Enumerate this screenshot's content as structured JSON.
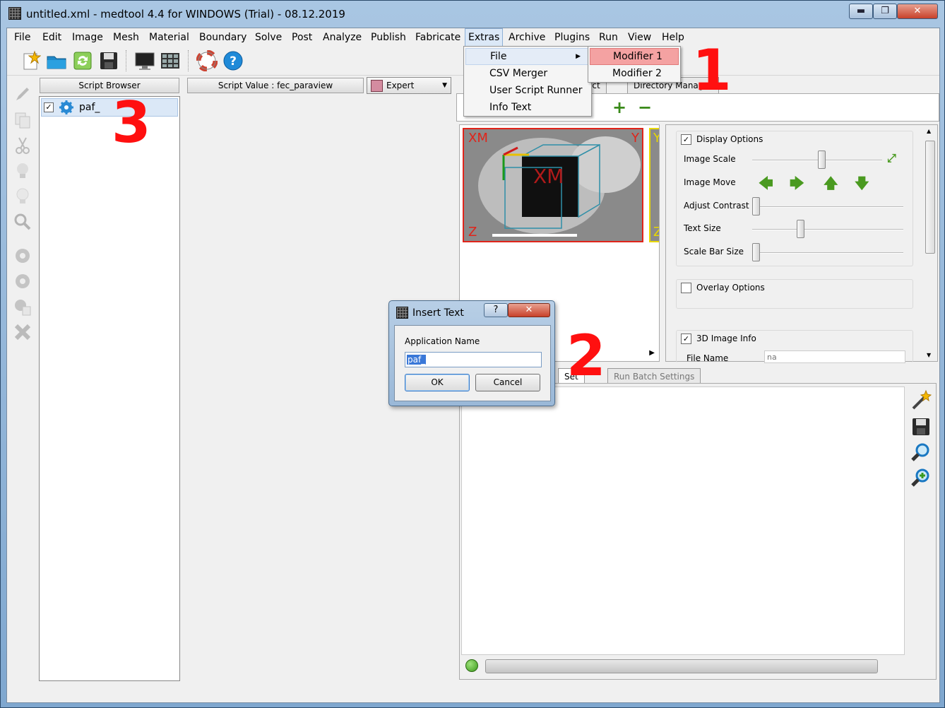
{
  "window": {
    "title": "untitled.xml - medtool 4.4 for WINDOWS (Trial) - 08.12.2019",
    "min_label": "▬",
    "max_label": "❐",
    "close_label": "✕"
  },
  "menubar": [
    "File",
    "Edit",
    "Image",
    "Mesh",
    "Material",
    "Boundary",
    "Solve",
    "Post",
    "Analyze",
    "Publish",
    "Fabricate",
    "Extras",
    "Archive",
    "Plugins",
    "Run",
    "View",
    "Help"
  ],
  "extras_menu": {
    "items": [
      "File",
      "CSV Merger",
      "User Script Runner",
      "Info Text"
    ],
    "file_submenu": [
      "Modifier 1",
      "Modifier 2"
    ]
  },
  "left_panel": {
    "header": "Script Browser",
    "tree_item": {
      "label": "paf_",
      "checked": "✓"
    }
  },
  "center_panel": {
    "header": "Script Value : fec_paraview",
    "mode": "Expert",
    "mode_arrow": "▼"
  },
  "right_panel": {
    "top_tabs": [
      "ect",
      "Directory Manager"
    ],
    "plus": "+",
    "minus": "−",
    "viewer": {
      "label_tl": "XM",
      "label_tr": "Y",
      "label_bl": "Z",
      "label_center": "XM",
      "label_v2": "Y",
      "label_v2_bottom": "Z",
      "scroll_arrow": "▶"
    },
    "options": {
      "display_options": {
        "label": "Display Options",
        "checked": "✓"
      },
      "image_scale": "Image Scale",
      "image_move": "Image Move",
      "adjust_contrast": "Adjust Contrast",
      "text_size": "Text Size",
      "scale_bar_size": "Scale Bar Size",
      "overlay_options": {
        "label": "Overlay Options",
        "checked": ""
      },
      "image_info": {
        "label": "3D Image Info",
        "checked": "✓"
      },
      "file_name_label": "File Name",
      "file_name_placeholder": "na",
      "sliders": {
        "image_scale": 0.46,
        "adjust_contrast": 0.0,
        "text_size": 0.31,
        "scale_bar_size": 0.0
      }
    },
    "bottom_tabs": [
      "Set",
      "Run Batch Settings"
    ]
  },
  "dialog": {
    "title": "Insert Text",
    "help": "?",
    "close": "✕",
    "field_label": "Application Name",
    "field_value": "paf_",
    "ok": "OK",
    "cancel": "Cancel"
  },
  "annotations": [
    "1",
    "2",
    "3"
  ],
  "colors": {
    "annotation": "#ff1010",
    "selection": "#dbe8f7",
    "submenu_highlight": "#f4a2a2"
  }
}
